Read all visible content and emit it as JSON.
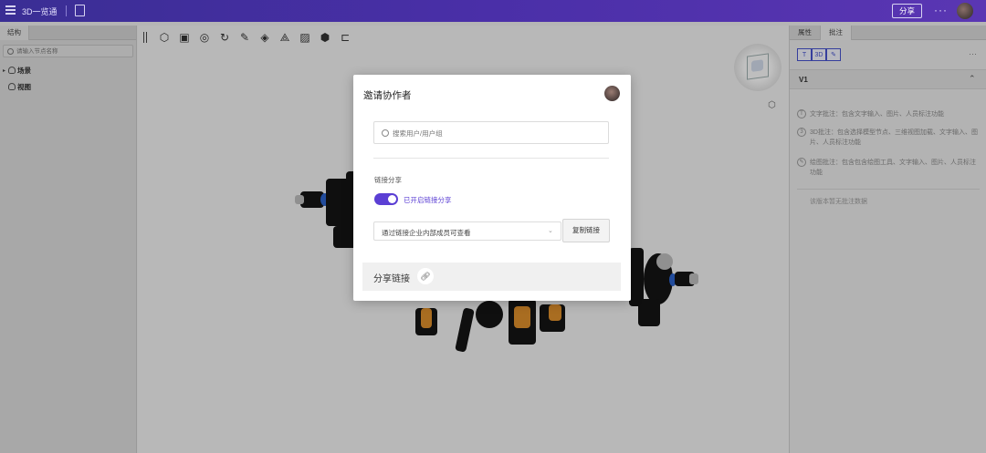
{
  "topbar": {
    "title": "3D一览通",
    "share_label": "分享",
    "more_label": "···"
  },
  "left_panel": {
    "tab": "结构",
    "search_placeholder": "请输入节点名称",
    "tree": [
      {
        "label": "场景",
        "expanded": true
      },
      {
        "label": "视图",
        "expanded": false
      }
    ]
  },
  "toolbar": {
    "tools": [
      "model-cube-icon",
      "fit-view-icon",
      "view-icon",
      "rotate-icon",
      "measure-icon",
      "section-icon",
      "explode-icon",
      "material-icon",
      "display-icon",
      "screen-icon"
    ]
  },
  "right_panel": {
    "tabs": [
      "属性",
      "批注"
    ],
    "active_tab": "批注",
    "tools": [
      "text-annotation-icon",
      "3d-annotation-icon",
      "draw-annotation-icon"
    ],
    "version": "V1",
    "descriptions": [
      {
        "icon": "text-annotation-icon",
        "text": "文字批注：包含文字输入、图片、人员标注功能"
      },
      {
        "icon": "3d-annotation-icon",
        "text": "3D批注：包含选择模型节点、三维视图加载、文字输入、图片、人员标注功能"
      },
      {
        "icon": "draw-annotation-icon",
        "text": "绘图批注：包含包含绘图工具、文字输入、图片、人员标注功能"
      }
    ],
    "no_data": "该版本暂无批注数据"
  },
  "modal": {
    "title": "邀请协作者",
    "search_placeholder": "搜索用户/用户组",
    "link_share_label": "链接分享",
    "toggle_on": true,
    "toggle_label": "已开启链接分享",
    "permission_value": "通过链接企业内部成员可查看",
    "copy_button": "复制链接",
    "share_link_label": "分享链接"
  },
  "colors": {
    "topbar": "#4a2fa8",
    "accent": "#5b3fd4",
    "annotation_tool": "#4450c8"
  }
}
